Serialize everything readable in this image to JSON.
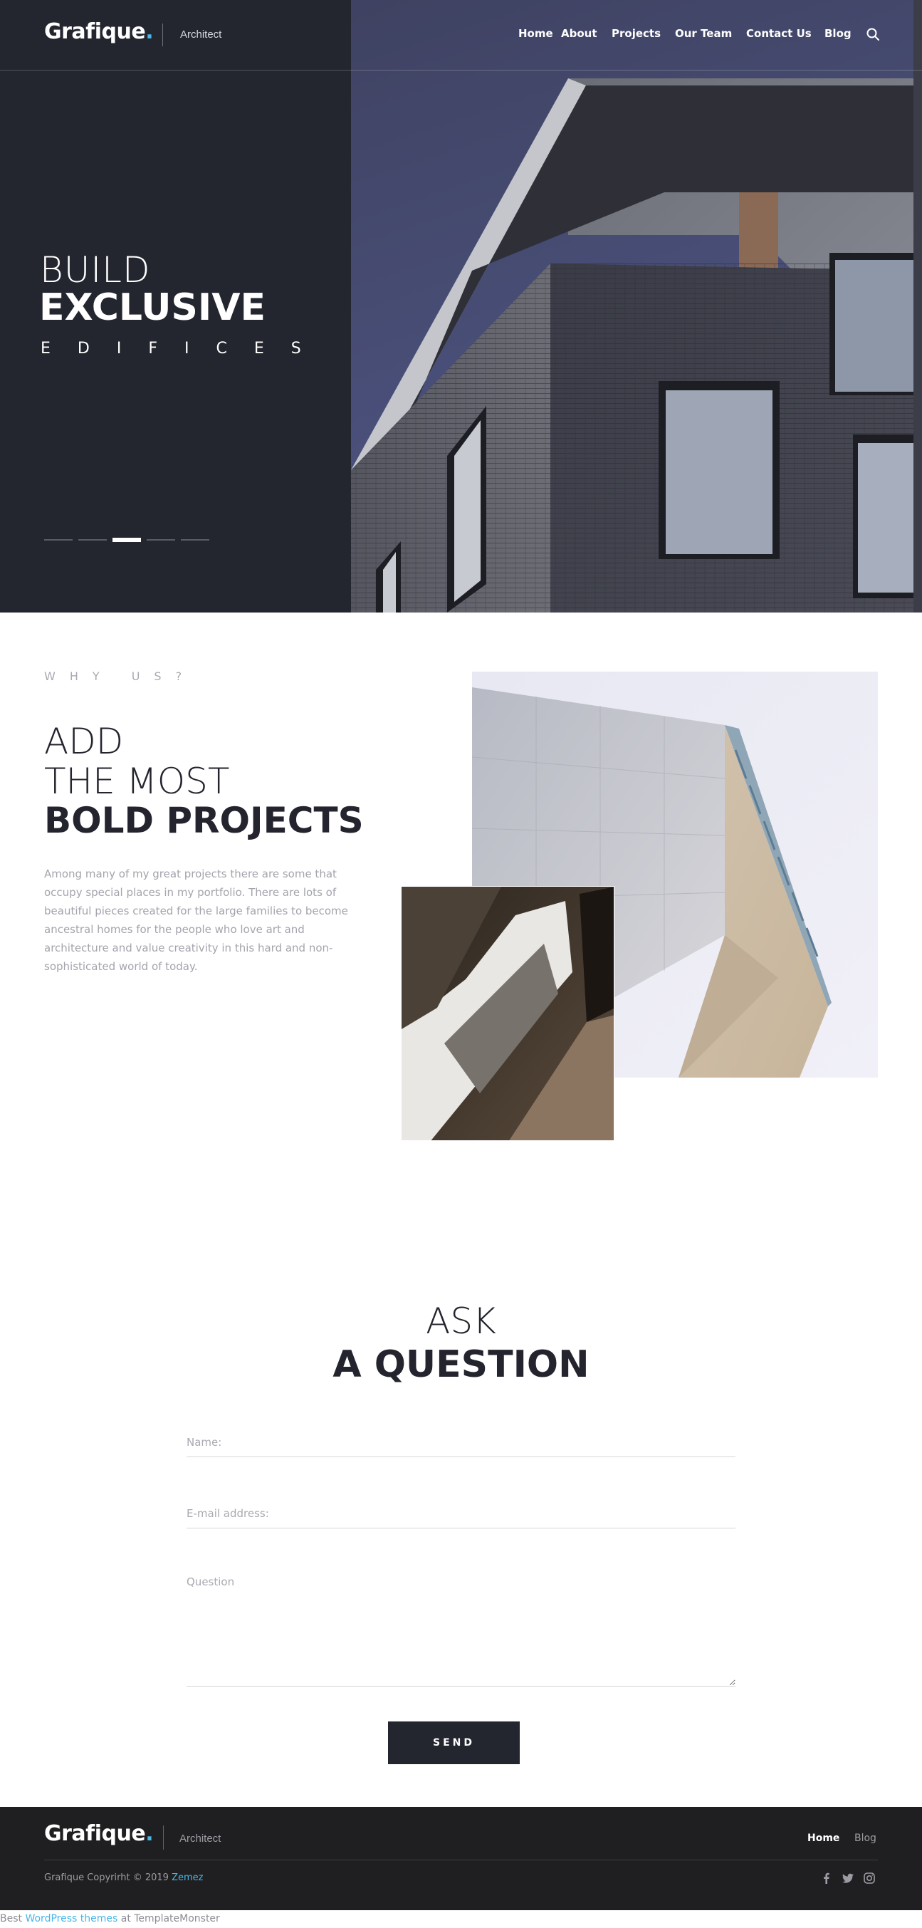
{
  "header": {
    "logo_text": "Grafique",
    "logo_dot": ".",
    "tagline": "Architect",
    "nav": [
      {
        "label": "Home"
      },
      {
        "label": "About"
      },
      {
        "label": "Projects"
      },
      {
        "label": "Our Team"
      },
      {
        "label": "Contact Us"
      },
      {
        "label": "Blog"
      }
    ],
    "search_icon": "search-icon"
  },
  "hero": {
    "line1": "BUILD",
    "line2": "EXCLUSIVE",
    "line3": "EDIFICES",
    "slider": {
      "slides": 5,
      "active": 3
    }
  },
  "why": {
    "label": "WHY US?",
    "heading_line1": "ADD",
    "heading_line2": "THE MOST",
    "heading_line3": "BOLD PROJECTS",
    "body": "Among many of my great projects there are some that occupy special places in my portfolio. There are lots of beautiful pieces created for the large families to become ancestral homes for the people who love art and architecture and value creativity in this hard and non-sophisticated world of today."
  },
  "ask": {
    "heading_line1": "ASK",
    "heading_line2": "A QUESTION",
    "name_placeholder": "Name:",
    "email_placeholder": "E-mail address:",
    "question_placeholder": "Question",
    "send_label": "SEND"
  },
  "footer": {
    "logo_text": "Grafique",
    "logo_dot": ".",
    "tagline": "Architect",
    "nav": [
      {
        "label": "Home",
        "active": true
      },
      {
        "label": "Blog",
        "active": false
      }
    ],
    "copyright_prefix": "Grafique Copyrirht © 2019",
    "copyright_link": "Zemez",
    "social": [
      "facebook-icon",
      "twitter-icon",
      "instagram-icon"
    ]
  },
  "credit": {
    "prefix": "Best",
    "link": "WordPress themes",
    "suffix": "at TemplateMonster"
  },
  "colors": {
    "dark": "#23252f",
    "accent": "#49b6e6",
    "footer": "#1f1f21"
  }
}
